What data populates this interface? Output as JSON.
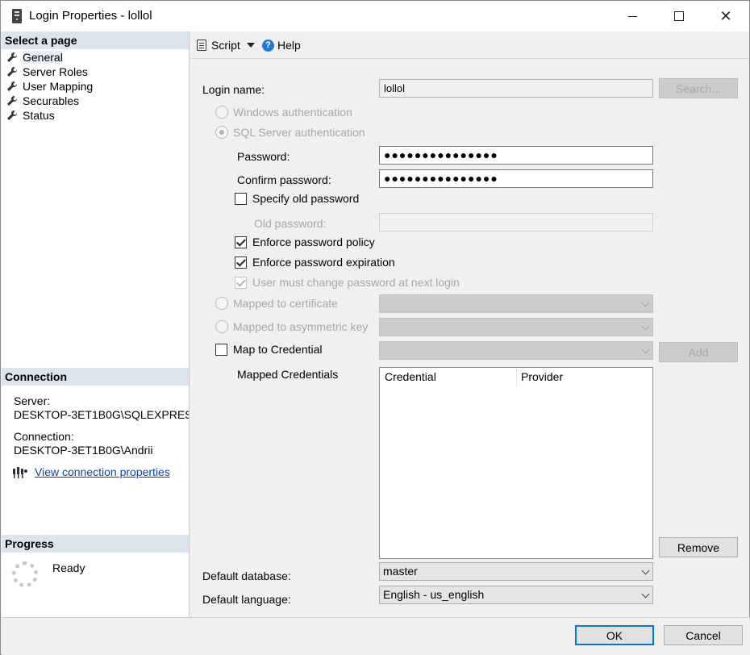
{
  "window": {
    "title": "Login Properties - lollol"
  },
  "left": {
    "select_page_header": "Select a page",
    "pages": [
      {
        "label": "General",
        "selected": true
      },
      {
        "label": "Server Roles"
      },
      {
        "label": "User Mapping"
      },
      {
        "label": "Securables"
      },
      {
        "label": "Status"
      }
    ],
    "connection_header": "Connection",
    "server_label": "Server:",
    "server_value": "DESKTOP-3ET1B0G\\SQLEXPRES",
    "connection_label": "Connection:",
    "connection_value": "DESKTOP-3ET1B0G\\Andrii",
    "view_connection_link": "View connection properties",
    "progress_header": "Progress",
    "progress_status": "Ready"
  },
  "toolbar": {
    "script_label": "Script",
    "help_label": "Help"
  },
  "form": {
    "login_name_label": "Login name:",
    "login_name_value": "lollol",
    "search_button": "Search...",
    "windows_auth": "Windows authentication",
    "sql_auth": "SQL Server authentication",
    "password_label": "Password:",
    "password_value": "●●●●●●●●●●●●●●●",
    "confirm_password_label": "Confirm password:",
    "confirm_password_value": "●●●●●●●●●●●●●●●",
    "specify_old_password": "Specify old password",
    "old_password_label": "Old password:",
    "enforce_policy": "Enforce password policy",
    "enforce_expiration": "Enforce password expiration",
    "must_change": "User must change password at next login",
    "mapped_certificate": "Mapped to certificate",
    "mapped_asym_key": "Mapped to asymmetric key",
    "map_credential": "Map to Credential",
    "add_button": "Add",
    "mapped_credentials_label": "Mapped Credentials",
    "grid_columns": [
      "Credential",
      "Provider"
    ],
    "remove_button": "Remove",
    "default_database_label": "Default database:",
    "default_database_value": "master",
    "default_language_label": "Default language:",
    "default_language_value": "English - us_english"
  },
  "footer": {
    "ok_button": "OK",
    "cancel_button": "Cancel"
  },
  "colors": {
    "section_header_bg": "#dbe4ef",
    "link": "#0645ad",
    "focus": "#0078d7"
  }
}
